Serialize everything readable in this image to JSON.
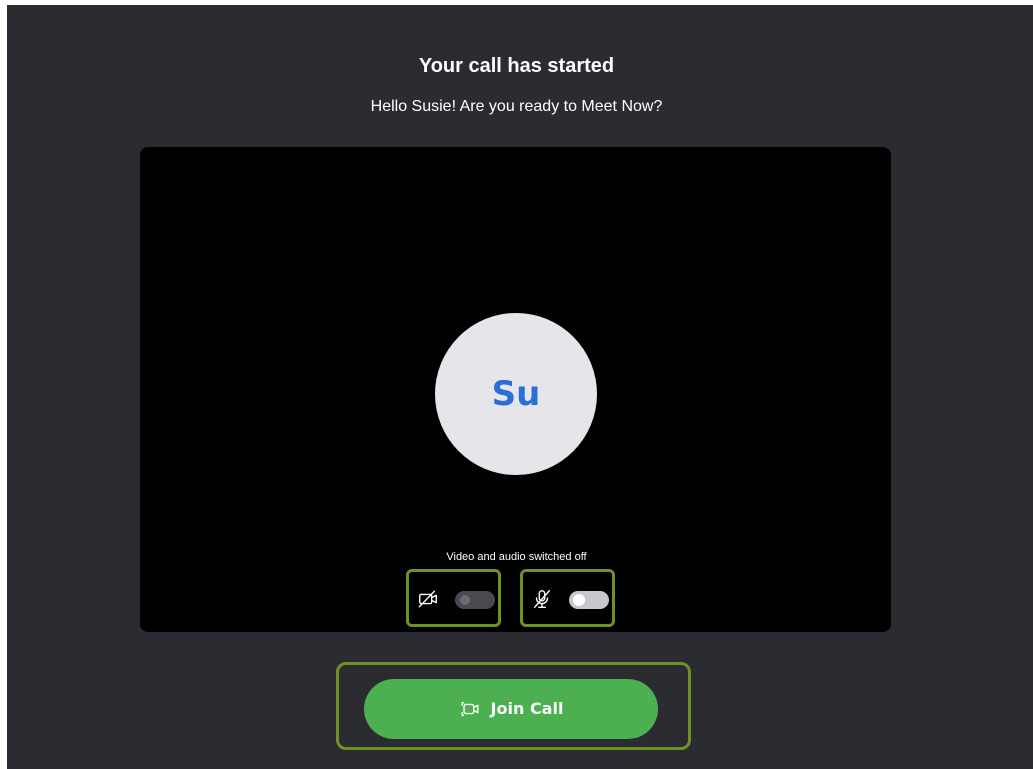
{
  "header": {
    "title": "Your call has started",
    "subtitle": "Hello Susie! Are you ready to Meet Now?"
  },
  "preview": {
    "avatar_initials": "Su",
    "status_text": "Video and audio switched off",
    "video_toggle": {
      "icon": "video-off-icon",
      "on": false
    },
    "audio_toggle": {
      "icon": "mic-off-icon",
      "on": false
    }
  },
  "join_button": {
    "label": "Join Call",
    "icon": "video-camera-icon"
  },
  "colors": {
    "background": "#2b2c31",
    "preview": "#000000",
    "avatar_bg": "#e6e6ea",
    "avatar_text": "#2a6fd6",
    "join_button": "#4caf50",
    "highlight_outline": "#6f9124"
  }
}
